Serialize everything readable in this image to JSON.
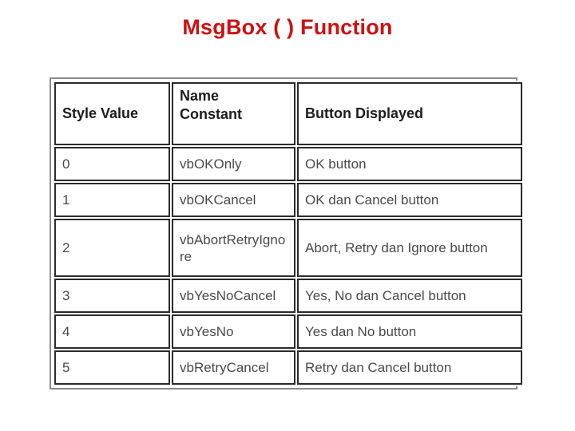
{
  "slide": {
    "title": "MsgBox ( ) Function",
    "title_color": "#CC1111",
    "background_color": "#FFFFFF"
  },
  "table": {
    "border_color_outer": "#8A8A8A",
    "border_color_cell": "#2B2B2B",
    "headers": {
      "col1": "Style Value",
      "col2": "Name\nConstant",
      "col3": "Button Displayed"
    },
    "rows": [
      {
        "style_value": "0",
        "name_constant": "vbOKOnly",
        "button_displayed": "OK button"
      },
      {
        "style_value": "1",
        "name_constant": "vbOKCancel",
        "button_displayed": "OK dan Cancel button"
      },
      {
        "style_value": "2",
        "name_constant": "vbAbortRetryIgnore",
        "button_displayed": "Abort, Retry dan Ignore button"
      },
      {
        "style_value": "3",
        "name_constant": "vbYesNoCancel",
        "button_displayed": "Yes, No dan Cancel button"
      },
      {
        "style_value": "4",
        "name_constant": "vbYesNo",
        "button_displayed": "Yes dan No button"
      },
      {
        "style_value": "5",
        "name_constant": "vbRetryCancel",
        "button_displayed": "Retry dan Cancel button"
      }
    ]
  }
}
